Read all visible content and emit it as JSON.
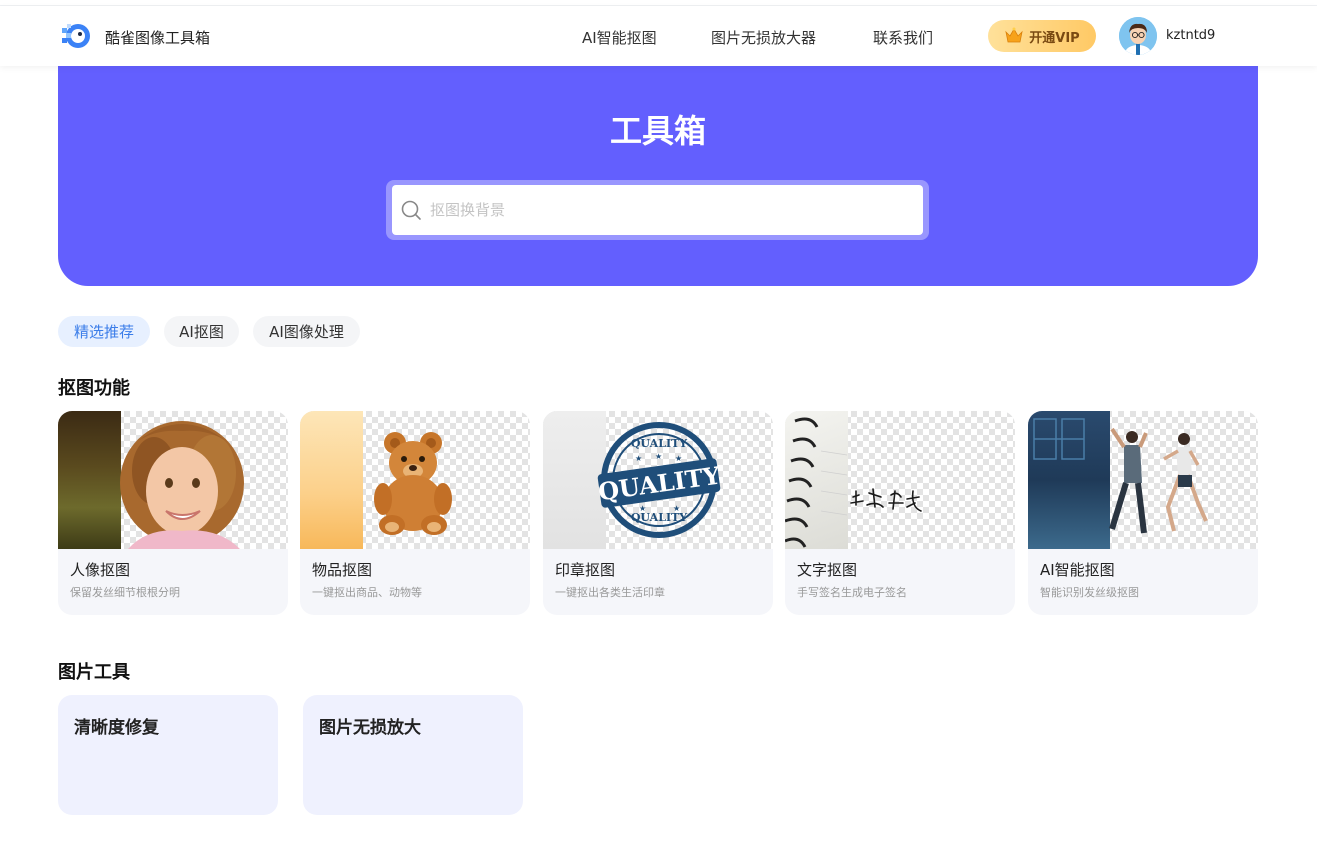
{
  "header": {
    "brand": "酷雀图像工具箱",
    "nav": [
      "AI智能抠图",
      "图片无损放大器",
      "联系我们"
    ],
    "vip_label": "开通VIP",
    "username": "kztntd9"
  },
  "hero": {
    "title": "工具箱",
    "search_placeholder": "抠图换背景"
  },
  "tabs": [
    {
      "label": "精选推荐",
      "active": true
    },
    {
      "label": "AI抠图",
      "active": false
    },
    {
      "label": "AI图像处理",
      "active": false
    }
  ],
  "sections": {
    "matting_title": "抠图功能",
    "tools_title": "图片工具"
  },
  "matting_cards": [
    {
      "title": "人像抠图",
      "desc": "保留发丝细节根根分明"
    },
    {
      "title": "物品抠图",
      "desc": "一键抠出商品、动物等"
    },
    {
      "title": "印章抠图",
      "desc": "一键抠出各类生活印章"
    },
    {
      "title": "文字抠图",
      "desc": "手写签名生成电子签名"
    },
    {
      "title": "AI智能抠图",
      "desc": "智能识别发丝级抠图"
    }
  ],
  "stamp_text": {
    "top": "QUALITY",
    "center": "QUALITY",
    "bottom": "QUALITY"
  },
  "tool_cards": [
    {
      "title": "清晰度修复"
    },
    {
      "title": "图片无损放大"
    }
  ],
  "colors": {
    "hero_bg": "#635ffe",
    "tab_active_bg": "#e7f0ff",
    "tab_active_text": "#3b7de9",
    "vip_gradient_start": "#ffe19a",
    "vip_gradient_end": "#ffc965",
    "card_bg": "#f5f6fa",
    "tool_card_bg": "#eff1fe"
  }
}
